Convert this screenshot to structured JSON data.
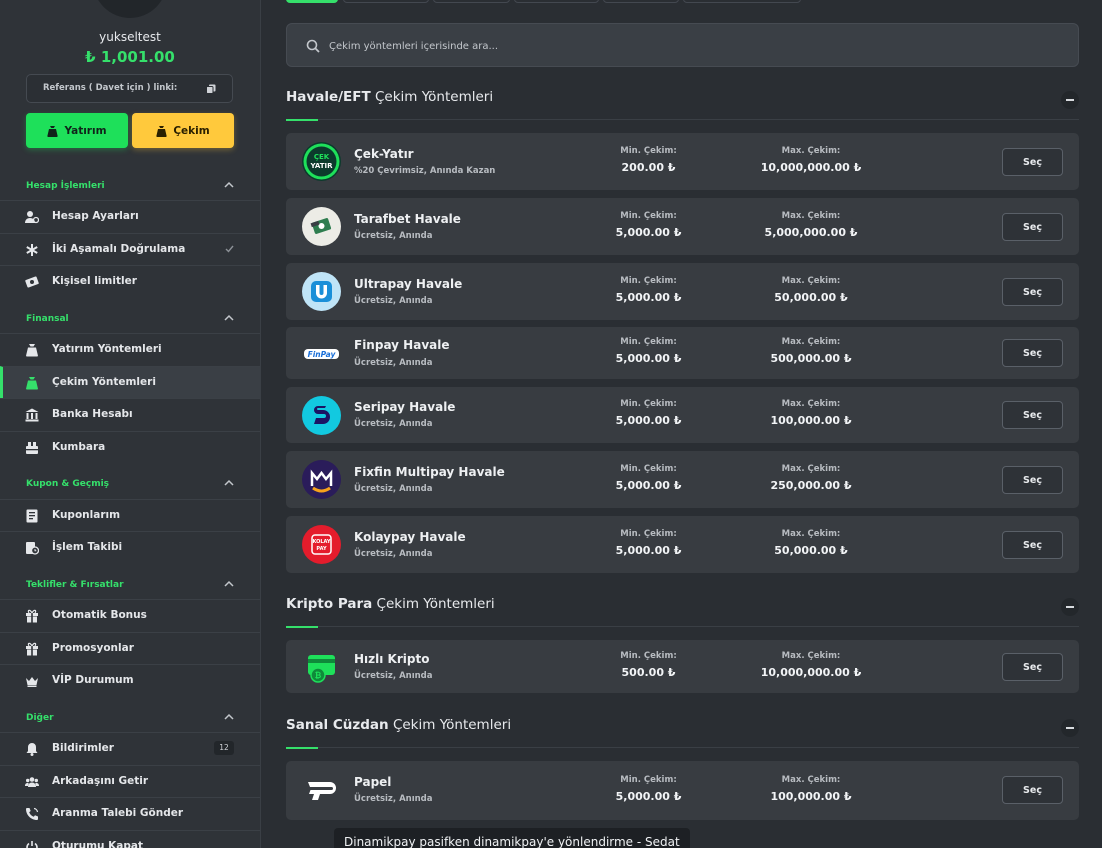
{
  "profile": {
    "username": "yukseltest",
    "balance": "₺ 1,001.00"
  },
  "referral": {
    "label": "Referans ( Davet için ) linki:"
  },
  "actions": {
    "deposit_label": "Yatırım",
    "withdraw_label": "Çekim"
  },
  "sidebar": {
    "sections": [
      {
        "title": "Hesap İşlemleri",
        "items": [
          {
            "label": "Hesap Ayarları",
            "icon": "user-settings-icon"
          },
          {
            "label": "İki Aşamalı Doğrulama",
            "icon": "asterisk-icon",
            "checked": true
          },
          {
            "label": "Kişisel limitler",
            "icon": "money-icon"
          }
        ]
      },
      {
        "title": "Finansal",
        "items": [
          {
            "label": "Yatırım Yöntemleri",
            "icon": "moneybag-icon"
          },
          {
            "label": "Çekim Yöntemleri",
            "icon": "moneybag-icon",
            "active": true
          },
          {
            "label": "Banka Hesabı",
            "icon": "bank-icon"
          },
          {
            "label": "Kumbara",
            "icon": "piggy-icon"
          }
        ]
      },
      {
        "title": "Kupon & Geçmiş",
        "items": [
          {
            "label": "Kuponlarım",
            "icon": "ticket-icon"
          },
          {
            "label": "İşlem Takibi",
            "icon": "history-icon"
          }
        ]
      },
      {
        "title": "Teklifler & Fırsatlar",
        "items": [
          {
            "label": "Otomatik Bonus",
            "icon": "gift-icon"
          },
          {
            "label": "Promosyonlar",
            "icon": "gift-icon"
          },
          {
            "label": "VİP Durumum",
            "icon": "crown-icon"
          }
        ]
      },
      {
        "title": "Diğer",
        "items": [
          {
            "label": "Bildirimler",
            "icon": "bell-icon",
            "badge": "12"
          },
          {
            "label": "Arkadaşını Getir",
            "icon": "users-icon"
          },
          {
            "label": "Aranma Talebi Gönder",
            "icon": "phone-icon"
          },
          {
            "label": "Oturumu Kapat",
            "icon": "power-icon"
          }
        ]
      }
    ]
  },
  "search": {
    "placeholder": "Çekim yöntemleri içerisinde ara..."
  },
  "groups": [
    {
      "title_bold": "Havale/EFT",
      "title_rest": " Çekim Yöntemleri"
    },
    {
      "title_bold": "Kripto Para",
      "title_rest": " Çekim Yöntemleri"
    },
    {
      "title_bold": "Sanal Cüzdan",
      "title_rest": " Çekim Yöntemleri"
    }
  ],
  "labels": {
    "min": "Min. Çekim:",
    "max": "Max. Çekim:",
    "select": "Seç"
  },
  "methods": [
    {
      "name": "Çek-Yatır",
      "sub": "%20 Çevrimsiz, Anında Kazan",
      "min": "200.00 ₺",
      "max": "10,000,000.00 ₺",
      "logo_text": "ÇEK YATIR",
      "color": "#0c3a2c"
    },
    {
      "name": "Tarafbet Havale",
      "sub": "Ücretsiz, Anında",
      "min": "5,000.00 ₺",
      "max": "5,000,000.00 ₺",
      "color": "#ecece6"
    },
    {
      "name": "Ultrapay Havale",
      "sub": "Ücretsiz, Anında",
      "min": "5,000.00 ₺",
      "max": "50,000.00 ₺",
      "logo_text": "U",
      "color": "#bfe4f7"
    },
    {
      "name": "Finpay Havale",
      "sub": "Ücretsiz, Anında",
      "min": "5,000.00 ₺",
      "max": "500,000.00 ₺",
      "logo_text": "FinPay",
      "color": "#383c41"
    },
    {
      "name": "Seripay Havale",
      "sub": "Ücretsiz, Anında",
      "min": "5,000.00 ₺",
      "max": "100,000.00 ₺",
      "logo_text": "S",
      "color": "#12c9e0"
    },
    {
      "name": "Fixfin Multipay Havale",
      "sub": "Ücretsiz, Anında",
      "min": "5,000.00 ₺",
      "max": "250,000.00 ₺",
      "logo_text": "M",
      "color": "#2a1c5a"
    },
    {
      "name": "Kolaypay Havale",
      "sub": "Ücretsiz, Anında",
      "min": "5,000.00 ₺",
      "max": "50,000.00 ₺",
      "logo_text": "KOLAY PAY",
      "color": "#e41c2c"
    },
    {
      "name": "Hızlı Kripto",
      "sub": "Ücretsiz, Anında",
      "min": "500.00 ₺",
      "max": "10,000,000.00 ₺",
      "color": "#383c41"
    },
    {
      "name": "Papel",
      "sub": "Ücretsiz, Anında",
      "min": "5,000.00 ₺",
      "max": "100,000.00 ₺",
      "color": "#383c41"
    }
  ],
  "tooltip": "Dinamikpay pasifken dinamikpay'e yönlendirme - Sedat"
}
